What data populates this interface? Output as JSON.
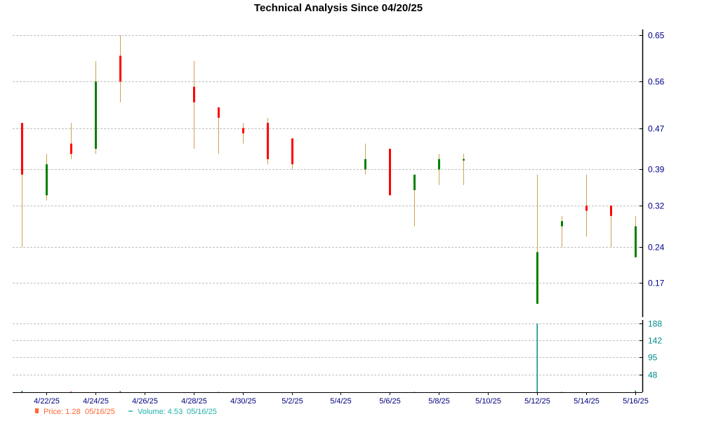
{
  "chart_data": {
    "type": "candlestick",
    "title": "Technical Analysis Since 04/20/25",
    "price_axis": {
      "ticks": [
        0.17,
        0.24,
        0.32,
        0.39,
        0.47,
        0.56,
        0.65
      ],
      "range": [
        0.115,
        0.65
      ]
    },
    "volume_axis": {
      "ticks": [
        48,
        95,
        142,
        188
      ],
      "range": [
        0,
        188
      ]
    },
    "x_axis": {
      "start_date": "4/21/25",
      "end_date": "5/16/25",
      "tick_labels": [
        "4/22/25",
        "4/24/25",
        "4/26/25",
        "4/28/25",
        "4/30/25",
        "5/2/25",
        "5/4/25",
        "5/6/25",
        "5/8/25",
        "5/10/25",
        "5/12/25",
        "5/14/25",
        "5/16/25"
      ]
    },
    "colors": {
      "up": "#008000",
      "down": "#ff0000",
      "wick": "#d2a050",
      "volume": "#008b8b",
      "grid": "#c0c0c0",
      "axis": "#000000",
      "legend_price": "#ff6633",
      "legend_volume": "#20b2aa"
    },
    "candles": [
      {
        "date": "4/21/25",
        "open": 0.48,
        "high": 0.48,
        "low": 0.24,
        "close": 0.38
      },
      {
        "date": "4/22/25",
        "open": 0.34,
        "high": 0.42,
        "low": 0.33,
        "close": 0.4
      },
      {
        "date": "4/23/25",
        "open": 0.44,
        "high": 0.48,
        "low": 0.41,
        "close": 0.42
      },
      {
        "date": "4/24/25",
        "open": 0.43,
        "high": 0.6,
        "low": 0.42,
        "close": 0.56
      },
      {
        "date": "4/25/25",
        "open": 0.61,
        "high": 0.65,
        "low": 0.52,
        "close": 0.56
      },
      {
        "date": "4/28/25",
        "open": 0.55,
        "high": 0.6,
        "low": 0.43,
        "close": 0.52
      },
      {
        "date": "4/29/25",
        "open": 0.51,
        "high": 0.51,
        "low": 0.42,
        "close": 0.49
      },
      {
        "date": "4/30/25",
        "open": 0.47,
        "high": 0.48,
        "low": 0.44,
        "close": 0.46
      },
      {
        "date": "5/1/25",
        "open": 0.48,
        "high": 0.49,
        "low": 0.4,
        "close": 0.41
      },
      {
        "date": "5/2/25",
        "open": 0.45,
        "high": 0.45,
        "low": 0.39,
        "close": 0.4
      },
      {
        "date": "5/5/25",
        "open": 0.39,
        "high": 0.44,
        "low": 0.38,
        "close": 0.41
      },
      {
        "date": "5/6/25",
        "open": 0.43,
        "high": 0.43,
        "low": 0.34,
        "close": 0.34
      },
      {
        "date": "5/7/25",
        "open": 0.35,
        "high": 0.38,
        "low": 0.28,
        "close": 0.38
      },
      {
        "date": "5/8/25",
        "open": 0.39,
        "high": 0.42,
        "low": 0.36,
        "close": 0.41
      },
      {
        "date": "5/9/25",
        "open": 0.41,
        "high": 0.42,
        "low": 0.36,
        "close": 0.41
      },
      {
        "date": "5/12/25",
        "open": 0.13,
        "high": 0.38,
        "low": 0.13,
        "close": 0.23
      },
      {
        "date": "5/13/25",
        "open": 0.28,
        "high": 0.3,
        "low": 0.24,
        "close": 0.29
      },
      {
        "date": "5/14/25",
        "open": 0.32,
        "high": 0.38,
        "low": 0.26,
        "close": 0.31
      },
      {
        "date": "5/15/25",
        "open": 0.32,
        "high": 0.32,
        "low": 0.24,
        "close": 0.3
      },
      {
        "date": "5/16/25",
        "open": 0.22,
        "high": 0.3,
        "low": 0.22,
        "close": 0.28
      }
    ],
    "volumes": [
      {
        "date": "4/21/25",
        "value": 4,
        "color": "#008000"
      },
      {
        "date": "4/23/25",
        "value": 2,
        "color": "#ff0000"
      },
      {
        "date": "4/25/25",
        "value": 3,
        "color": "#008000"
      },
      {
        "date": "4/29/25",
        "value": 1,
        "color": "#ff0000"
      },
      {
        "date": "5/7/25",
        "value": 1,
        "color": "#008000"
      },
      {
        "date": "5/12/25",
        "value": 188,
        "color": "#008b8b"
      },
      {
        "date": "5/13/25",
        "value": 1,
        "color": "#ff0000"
      },
      {
        "date": "5/16/25",
        "value": 4.53,
        "color": "#008000"
      }
    ],
    "legend": {
      "price_label": "Price: 1.28",
      "price_date": "05/16/25",
      "volume_label": "Volume: 4.53",
      "volume_date": "05/16/25"
    }
  }
}
